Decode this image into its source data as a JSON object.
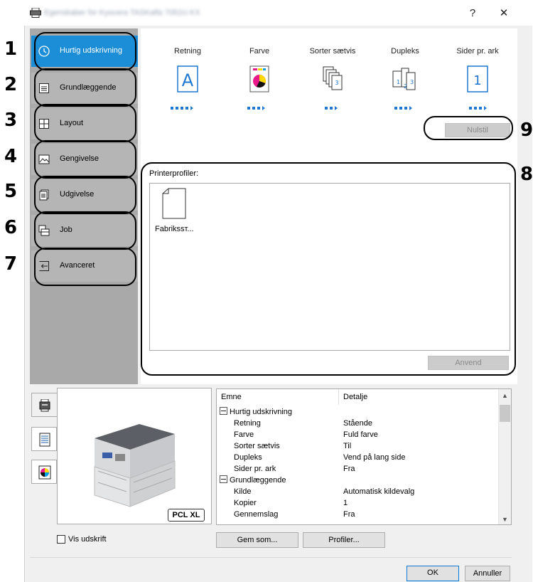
{
  "window": {
    "title": "Egenskaber for Kyocera TASKalfa 7052ci KX",
    "help": "?",
    "close": "✕",
    "printer_icon": "printer-icon"
  },
  "callouts": [
    "1",
    "2",
    "3",
    "4",
    "5",
    "6",
    "7",
    "8",
    "9"
  ],
  "nav": [
    {
      "label": "Hurtig udskrivning",
      "icon": "clock-icon"
    },
    {
      "label": "Grundlæggende",
      "icon": "document-lines-icon"
    },
    {
      "label": "Layout",
      "icon": "grid-icon"
    },
    {
      "label": "Gengivelse",
      "icon": "image-icon"
    },
    {
      "label": "Udgivelse",
      "icon": "stack-document-icon"
    },
    {
      "label": "Job",
      "icon": "job-icon"
    },
    {
      "label": "Avanceret",
      "icon": "arrow-back-icon"
    }
  ],
  "columns": [
    {
      "label": "Retning"
    },
    {
      "label": "Farve"
    },
    {
      "label": "Sorter sætvis"
    },
    {
      "label": "Dupleks"
    },
    {
      "label": "Sider pr. ark"
    }
  ],
  "icons": {
    "retning_letter": "A",
    "sider_number": "1"
  },
  "reset_label": "Nulstil",
  "profiles": {
    "label": "Printerprofiler:",
    "item": "Fabrikssт..."
  },
  "apply_label": "Anvend",
  "pcl_badge": "PCL XL",
  "summary": {
    "col_subject": "Emne",
    "col_detail": "Detalje",
    "rows": [
      {
        "subject": "Hurtig udskrivning",
        "detail": "",
        "group": true
      },
      {
        "subject": "Retning",
        "detail": "Stående"
      },
      {
        "subject": "Farve",
        "detail": "Fuld farve"
      },
      {
        "subject": "Sorter sætvis",
        "detail": "Til"
      },
      {
        "subject": "Dupleks",
        "detail": "Vend på lang side"
      },
      {
        "subject": "Sider pr. ark",
        "detail": "Fra"
      },
      {
        "subject": "Grundlæggende",
        "detail": "",
        "group": true
      },
      {
        "subject": "Kilde",
        "detail": "Automatisk kildevalg"
      },
      {
        "subject": "Kopier",
        "detail": "1"
      },
      {
        "subject": "Gennemslag",
        "detail": "Fra"
      }
    ]
  },
  "show_print_label": "Vis udskrift",
  "save_as_label": "Gem som...",
  "profiles_button_label": "Profiler...",
  "ok_label": "OK",
  "cancel_label": "Annuller",
  "colors": {
    "accent": "#1c8ed7",
    "nav_bg": "#b5b5b5",
    "dots": "#1f77d0"
  }
}
